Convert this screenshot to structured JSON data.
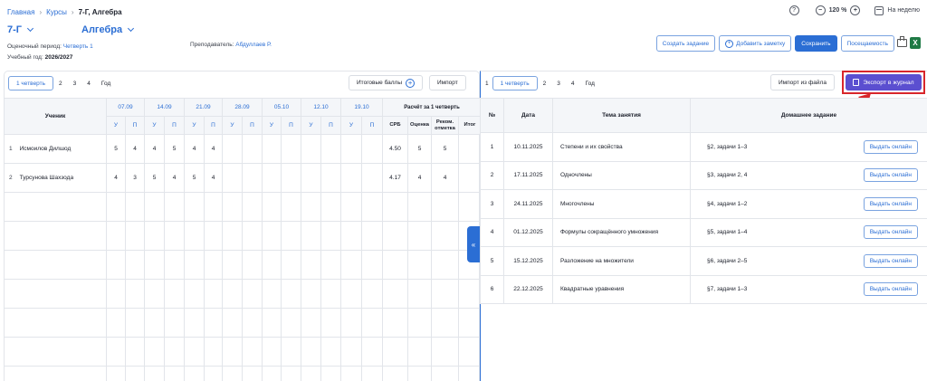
{
  "breadcrumbs": {
    "home": "Главная",
    "courses": "Курсы",
    "current": "7-Г, Алгебра"
  },
  "toolbar": {
    "help_icon": "?",
    "zoom_minus": "−",
    "zoom_value": "120 %",
    "zoom_plus": "+",
    "week_label": "На неделю"
  },
  "header": {
    "class_name": "7-Г",
    "subject": "Алгебра",
    "period_label": "Оценочный период:",
    "period_value": "Четверть 1",
    "year_label": "Учебный год:",
    "year_value": "2026/2027",
    "teacher_label": "Преподаватель:",
    "teacher_value": "Абдуллаев Р."
  },
  "actions": {
    "create_task": "Создать задание",
    "add_note": "Добавить заметку",
    "save": "Сохранить",
    "attendance": "Посещаемость"
  },
  "left_panel": {
    "tabs": [
      "1 четверть",
      "2",
      "3",
      "4",
      "Год"
    ],
    "final_scores": "Итоговые баллы",
    "import": "Импорт",
    "collapse": "«",
    "student_header": "Ученик",
    "dates": [
      "07.09",
      "14.09",
      "21.09",
      "28.09",
      "05.10",
      "12.10",
      "19.10"
    ],
    "sub_u": "У",
    "sub_p": "П",
    "calc_header": "Расчёт за 1 четверть",
    "calc_cols": [
      "СРБ",
      "Оценка",
      "Реком. отметка",
      "Итог"
    ],
    "students": [
      {
        "num": "1",
        "name": "Исмоилов Дилшод",
        "marks": [
          "5",
          "4",
          "4",
          "5",
          "4",
          "4"
        ],
        "srb": "4.50",
        "grade": "5",
        "rec": "5",
        "final": ""
      },
      {
        "num": "2",
        "name": "Турсунова Шахзода",
        "marks": [
          "4",
          "3",
          "5",
          "4",
          "5",
          "4"
        ],
        "srb": "4.17",
        "grade": "4",
        "rec": "4",
        "final": ""
      }
    ]
  },
  "right_panel": {
    "tabs": [
      "1",
      "1 четверть",
      "2",
      "3",
      "4",
      "Год"
    ],
    "import_file": "Импорт из файла",
    "export": "Экспорт в журнал",
    "columns": [
      "№",
      "Дата",
      "Тема занятия",
      "Домашнее задание"
    ],
    "issue_label": "Выдать онлайн",
    "lessons": [
      {
        "num": "1",
        "date": "10.11.2025",
        "topic": "Степени и их свойства",
        "homework": "§2, задачи 1–3"
      },
      {
        "num": "2",
        "date": "17.11.2025",
        "topic": "Одночлены",
        "homework": "§3, задачи 2, 4"
      },
      {
        "num": "3",
        "date": "24.11.2025",
        "topic": "Многочлены",
        "homework": "§4, задачи 1–2"
      },
      {
        "num": "4",
        "date": "01.12.2025",
        "topic": "Формулы сокращённого умножения",
        "homework": "§5, задачи 1–4"
      },
      {
        "num": "5",
        "date": "15.12.2025",
        "topic": "Разложение на множители",
        "homework": "§6, задачи 2–5"
      },
      {
        "num": "6",
        "date": "22.12.2025",
        "topic": "Квадратные уравнения",
        "homework": "§7, задачи 1–3"
      }
    ]
  },
  "colors": {
    "accent": "#2b6ed4",
    "export": "#5b4fd0",
    "highlight": "#d8262b"
  }
}
